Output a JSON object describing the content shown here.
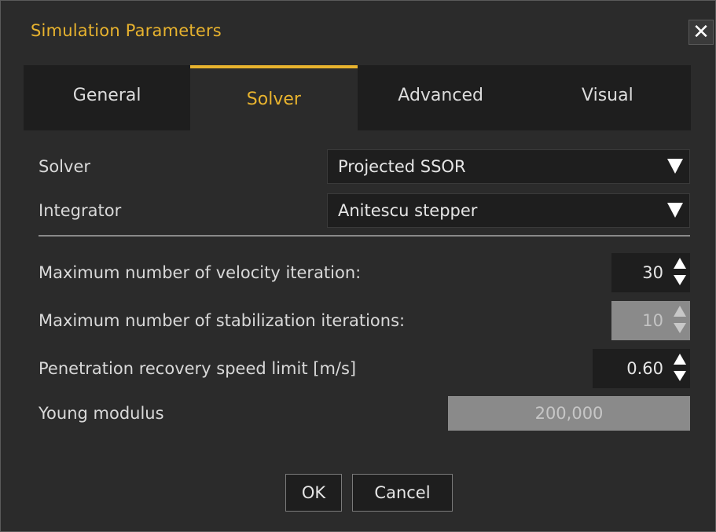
{
  "window": {
    "title": "Simulation Parameters",
    "close_glyph": "✕",
    "close_icon": "close-icon"
  },
  "tabs": [
    {
      "label": "General",
      "active": false
    },
    {
      "label": "Solver",
      "active": true
    },
    {
      "label": "Advanced",
      "active": false
    },
    {
      "label": "Visual",
      "active": false
    }
  ],
  "form": {
    "solver": {
      "label": "Solver",
      "value": "Projected SSOR"
    },
    "integrator": {
      "label": "Integrator",
      "value": "Anitescu stepper"
    },
    "velocity_iterations": {
      "label": "Maximum number of velocity iteration:",
      "value": "30"
    },
    "stabilization_iterations": {
      "label": "Maximum number of stabilization iterations:",
      "value": "10",
      "enabled": false
    },
    "penetration_speed": {
      "label": "Penetration recovery speed limit [m/s]",
      "value": "0.60"
    },
    "young_modulus": {
      "label": "Young modulus",
      "value": "200,000",
      "enabled": false
    }
  },
  "buttons": {
    "ok": "OK",
    "cancel": "Cancel"
  },
  "colors": {
    "accent": "#e8b32e",
    "background": "#2b2b2b",
    "field": "#1e1e1e",
    "disabled_field": "#8a8a8a"
  }
}
